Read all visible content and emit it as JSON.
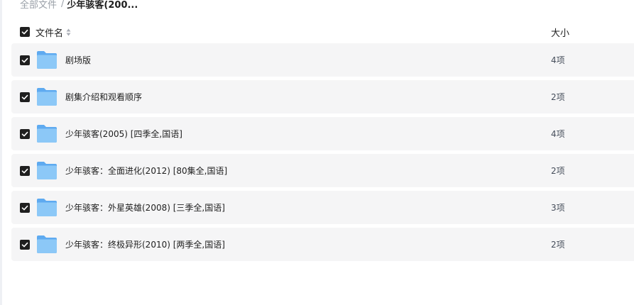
{
  "breadcrumb": {
    "root": "全部文件",
    "separator": "/",
    "current": "少年骇客(200..."
  },
  "header": {
    "name_label": "文件名",
    "size_label": "大小",
    "all_checked": true
  },
  "files": [
    {
      "name": "剧场版",
      "size": "4项",
      "checked": true,
      "icon": "folder-icon"
    },
    {
      "name": "剧集介绍和观看顺序",
      "size": "2项",
      "checked": true,
      "icon": "folder-icon"
    },
    {
      "name": "少年骇客(2005) [四季全,国语]",
      "size": "4项",
      "checked": true,
      "icon": "folder-icon"
    },
    {
      "name": "少年骇客：全面进化(2012) [80集全,国语]",
      "size": "2项",
      "checked": true,
      "icon": "folder-icon"
    },
    {
      "name": "少年骇客：外星英雄(2008) [三季全,国语]",
      "size": "3项",
      "checked": true,
      "icon": "folder-icon"
    },
    {
      "name": "少年骇客：终极异形(2010) [两季全,国语]",
      "size": "2项",
      "checked": true,
      "icon": "folder-icon"
    }
  ],
  "colors": {
    "row_background": "#f5f5f6",
    "checkbox": "#1f1f1f",
    "folder_front": "#8cc8f7",
    "folder_back": "#5eaaf0",
    "muted_text": "#9aa0a8"
  }
}
